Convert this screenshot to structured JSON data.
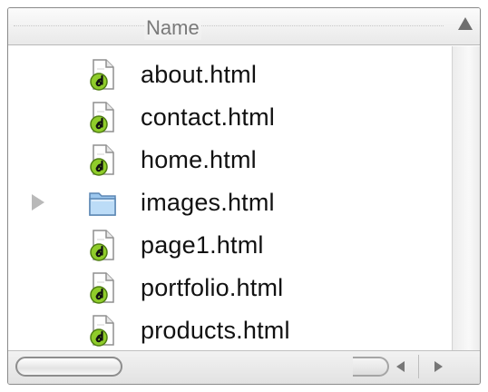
{
  "header": {
    "column_label": "Name",
    "sort_direction": "ascending"
  },
  "files": [
    {
      "name": "about.html",
      "kind": "html-file",
      "icon": "dreamweaver-document-icon"
    },
    {
      "name": "contact.html",
      "kind": "html-file",
      "icon": "dreamweaver-document-icon"
    },
    {
      "name": "home.html",
      "kind": "html-file",
      "icon": "dreamweaver-document-icon"
    },
    {
      "name": "images.html",
      "kind": "folder",
      "icon": "folder-icon",
      "collapsed": true
    },
    {
      "name": "page1.html",
      "kind": "html-file",
      "icon": "dreamweaver-document-icon"
    },
    {
      "name": "portfolio.html",
      "kind": "html-file",
      "icon": "dreamweaver-document-icon"
    },
    {
      "name": "products.html",
      "kind": "html-file",
      "icon": "dreamweaver-document-icon"
    }
  ],
  "colors": {
    "doc_badge_green": "#8fcc2a",
    "folder_blue": "#9cc7ee",
    "text": "#111111",
    "header_text": "#7a7a7a"
  }
}
